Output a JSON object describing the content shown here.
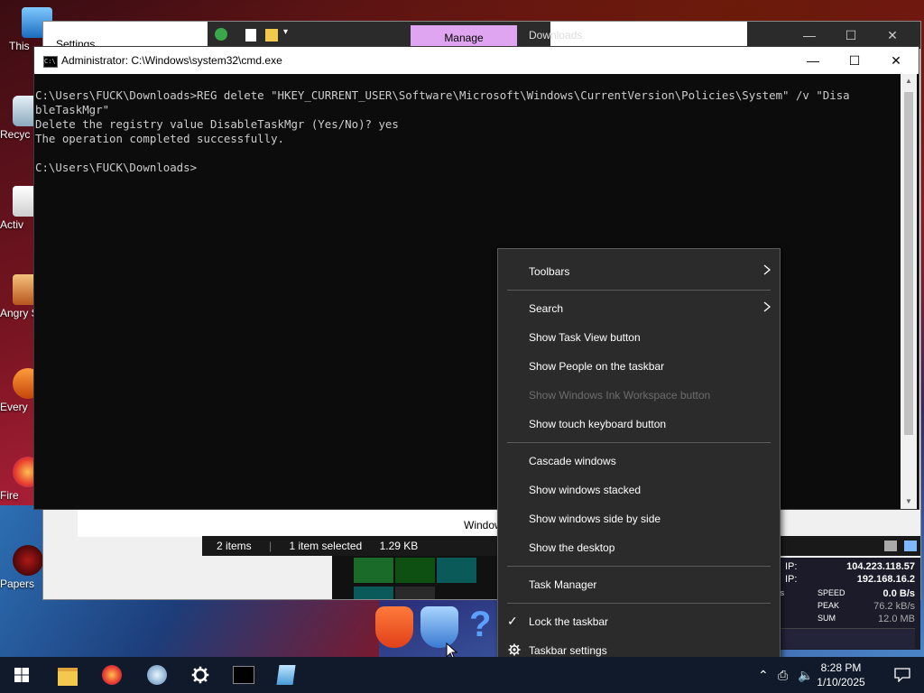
{
  "explorer": {
    "title": "Settings",
    "manage_tab": "Manage",
    "window_title": "Downloads",
    "status": {
      "items": "2 items",
      "selected": "1 item selected",
      "size": "1.29 KB"
    },
    "path_text": "Windows (CRL"
  },
  "cmd": {
    "title": "Administrator: C:\\Windows\\system32\\cmd.exe",
    "lines": [
      "C:\\Users\\FUCK\\Downloads>REG delete \"HKEY_CURRENT_USER\\Software\\Microsoft\\Windows\\CurrentVersion\\Policies\\System\" /v \"Disa",
      "bleTaskMgr\"",
      "Delete the registry value DisableTaskMgr (Yes/No)? yes",
      "The operation completed successfully.",
      "",
      "C:\\Users\\FUCK\\Downloads>"
    ]
  },
  "desktop": {
    "icons": [
      "This",
      "Recyc",
      "Activ",
      "Angry Seas",
      "Every",
      "Fire",
      "Papers, F"
    ]
  },
  "context_menu": {
    "items": [
      {
        "label": "Toolbars",
        "submenu": true
      },
      {
        "label": "Search",
        "submenu": true
      },
      {
        "label": "Show Task View button"
      },
      {
        "label": "Show People on the taskbar"
      },
      {
        "label": "Show Windows Ink Workspace button",
        "disabled": true
      },
      {
        "label": "Show touch keyboard button"
      },
      {
        "label": "Cascade windows"
      },
      {
        "label": "Show windows stacked"
      },
      {
        "label": "Show windows side by side"
      },
      {
        "label": "Show the desktop"
      },
      {
        "label": "Task Manager"
      },
      {
        "label": "Lock the taskbar",
        "checked": true
      },
      {
        "label": "Taskbar settings",
        "icon": "gear-icon"
      }
    ]
  },
  "network_widget": {
    "ext_ip_label": "IP:",
    "ext_ip": "104.223.118.57",
    "int_ip_label": "IP:",
    "int_ip": "192.168.16.2",
    "speed_label": "SPEED",
    "speed": "0.0 B/s",
    "peak_label": "PEAK",
    "peak": "76.2 kB/s",
    "sum_label": "SUM",
    "sum": "12.0 MB",
    "unit_top": "/s"
  },
  "taskbar": {
    "time": "8:28 PM",
    "date": "1/10/2025"
  },
  "colors": {
    "accent": "#e0a5f0",
    "menu_bg": "#2b2b2b",
    "taskbar_bg": "#101a2a"
  }
}
